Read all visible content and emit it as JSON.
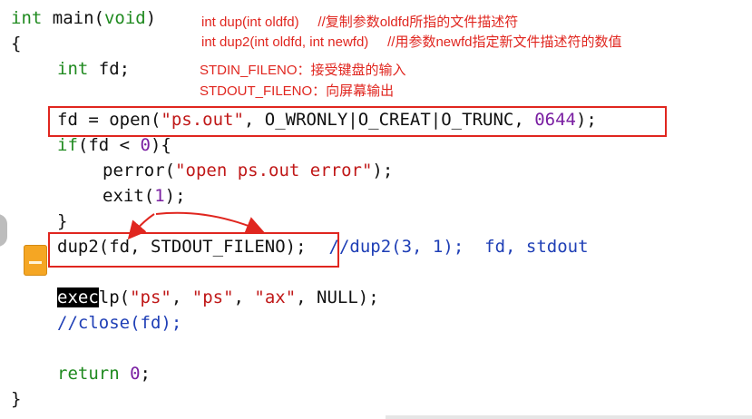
{
  "code": {
    "line1": {
      "type": "int",
      "rest": " main(",
      "void": "void",
      "close": ")"
    },
    "line2": "{",
    "line3": {
      "type": "int",
      "rest": " fd;"
    },
    "line4": {
      "a": "fd = open(",
      "s": "\"ps.out\"",
      "b": ", O_WRONLY|O_CREAT|O_TRUNC, ",
      "n": "0644",
      "c": ");"
    },
    "line5": {
      "kw": "if",
      "a": "(fd < ",
      "n": "0",
      "b": "){"
    },
    "line6": {
      "a": "perror(",
      "s": "\"open ps.out error\"",
      "b": ");"
    },
    "line7": {
      "a": "exit(",
      "n": "1",
      "b": ");"
    },
    "line8": "}",
    "line9": {
      "a": "dup2(fd, STDOUT_FILENO);",
      "c": "//dup2(3, 1);  fd, stdout"
    },
    "line10": {
      "hl": "exec",
      "a": "lp(",
      "s1": "\"ps\"",
      "sep1": ", ",
      "s2": "\"ps\"",
      "sep2": ", ",
      "s3": "\"ax\"",
      "b": ", NULL);"
    },
    "line11": "//close(fd);",
    "line12": {
      "kw": "return",
      "sp": " ",
      "n": "0",
      "b": ";"
    },
    "line13": "}"
  },
  "annotations": {
    "dup": "int dup(int oldfd)     //复制参数oldfd所指的文件描述符",
    "dup2": "int dup2(int oldfd, int newfd)     //用参数newfd指定新文件描述符的数值",
    "stdin": "STDIN_FILENO：接受键盘的输入",
    "stdout": "STDOUT_FILENO：向屏幕输出"
  },
  "colors": {
    "keyword": "#1f8a1f",
    "string": "#c01818",
    "number": "#7a1fa2",
    "comment": "#1f3fb6",
    "annotation": "#e0261f"
  }
}
